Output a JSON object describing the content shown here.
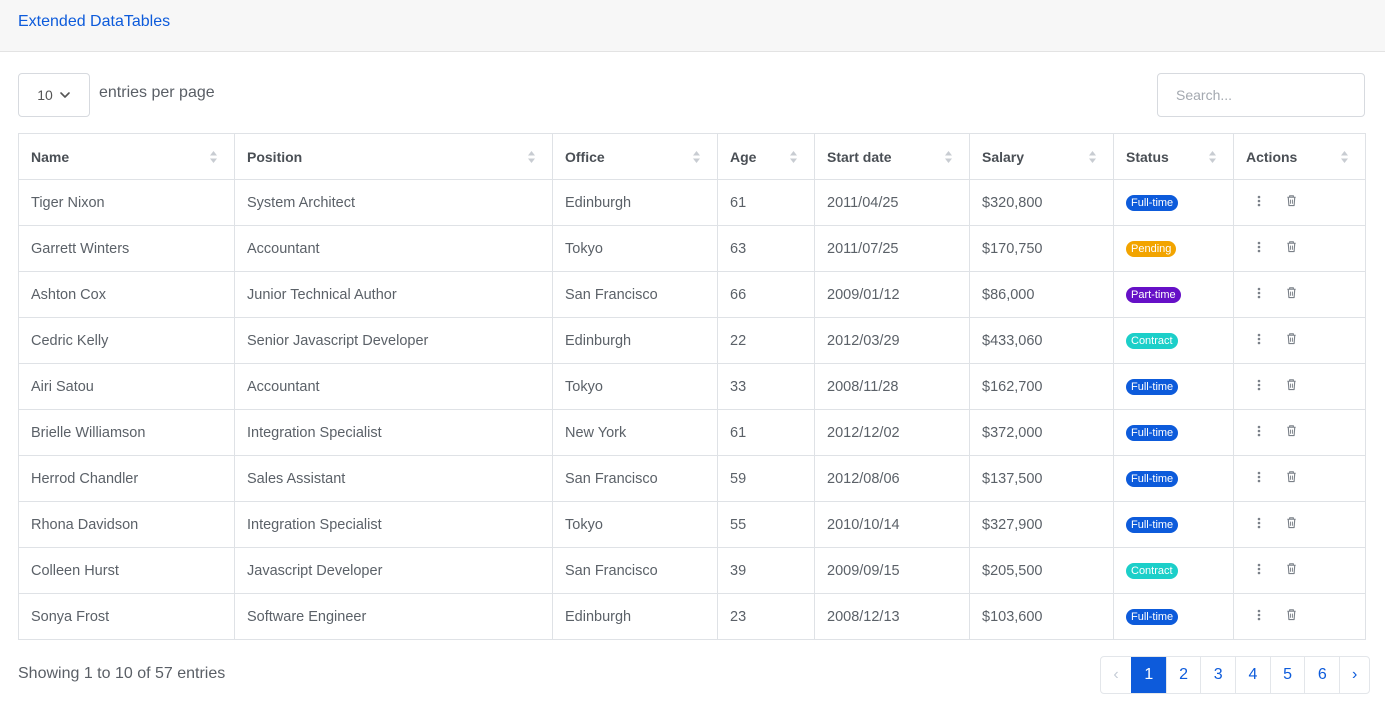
{
  "header": {
    "title": "Extended DataTables"
  },
  "controls": {
    "entries_value": "10",
    "entries_label": "entries per page",
    "search_placeholder": "Search..."
  },
  "colors": {
    "accent": "#0d5bdb",
    "full_time": "#0d5bdb",
    "pending": "#f2a400",
    "part_time": "#6610c7",
    "contract": "#1ccfc9"
  },
  "table": {
    "columns": [
      "Name",
      "Position",
      "Office",
      "Age",
      "Start date",
      "Salary",
      "Status",
      "Actions"
    ],
    "rows": [
      {
        "name": "Tiger Nixon",
        "position": "System Architect",
        "office": "Edinburgh",
        "age": "61",
        "start": "2011/04/25",
        "salary": "$320,800",
        "status": "Full-time",
        "status_color": "#0d5bdb"
      },
      {
        "name": "Garrett Winters",
        "position": "Accountant",
        "office": "Tokyo",
        "age": "63",
        "start": "2011/07/25",
        "salary": "$170,750",
        "status": "Pending",
        "status_color": "#f2a400"
      },
      {
        "name": "Ashton Cox",
        "position": "Junior Technical Author",
        "office": "San Francisco",
        "age": "66",
        "start": "2009/01/12",
        "salary": "$86,000",
        "status": "Part-time",
        "status_color": "#6610c7"
      },
      {
        "name": "Cedric Kelly",
        "position": "Senior Javascript Developer",
        "office": "Edinburgh",
        "age": "22",
        "start": "2012/03/29",
        "salary": "$433,060",
        "status": "Contract",
        "status_color": "#1ccfc9"
      },
      {
        "name": "Airi Satou",
        "position": "Accountant",
        "office": "Tokyo",
        "age": "33",
        "start": "2008/11/28",
        "salary": "$162,700",
        "status": "Full-time",
        "status_color": "#0d5bdb"
      },
      {
        "name": "Brielle Williamson",
        "position": "Integration Specialist",
        "office": "New York",
        "age": "61",
        "start": "2012/12/02",
        "salary": "$372,000",
        "status": "Full-time",
        "status_color": "#0d5bdb"
      },
      {
        "name": "Herrod Chandler",
        "position": "Sales Assistant",
        "office": "San Francisco",
        "age": "59",
        "start": "2012/08/06",
        "salary": "$137,500",
        "status": "Full-time",
        "status_color": "#0d5bdb"
      },
      {
        "name": "Rhona Davidson",
        "position": "Integration Specialist",
        "office": "Tokyo",
        "age": "55",
        "start": "2010/10/14",
        "salary": "$327,900",
        "status": "Full-time",
        "status_color": "#0d5bdb"
      },
      {
        "name": "Colleen Hurst",
        "position": "Javascript Developer",
        "office": "San Francisco",
        "age": "39",
        "start": "2009/09/15",
        "salary": "$205,500",
        "status": "Contract",
        "status_color": "#1ccfc9"
      },
      {
        "name": "Sonya Frost",
        "position": "Software Engineer",
        "office": "Edinburgh",
        "age": "23",
        "start": "2008/12/13",
        "salary": "$103,600",
        "status": "Full-time",
        "status_color": "#0d5bdb"
      }
    ]
  },
  "footer": {
    "info": "Showing 1 to 10 of 57 entries"
  },
  "pagination": {
    "prev": "‹",
    "next": "›",
    "pages": [
      "1",
      "2",
      "3",
      "4",
      "5",
      "6"
    ],
    "active": "1"
  }
}
